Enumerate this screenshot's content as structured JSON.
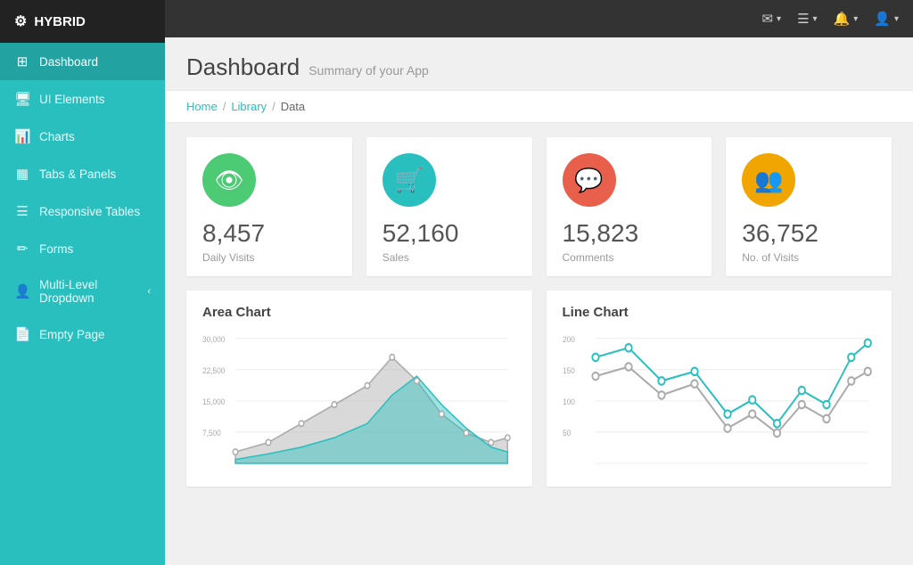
{
  "app": {
    "name": "HYBRID",
    "logo_icon": "⚙"
  },
  "topbar": {
    "items": [
      {
        "id": "mail",
        "icon": "✉",
        "has_dropdown": true
      },
      {
        "id": "menu",
        "icon": "☰",
        "has_dropdown": true
      },
      {
        "id": "bell",
        "icon": "🔔",
        "has_dropdown": true
      },
      {
        "id": "user",
        "icon": "👤",
        "has_dropdown": true
      }
    ]
  },
  "sidebar": {
    "items": [
      {
        "id": "dashboard",
        "label": "Dashboard",
        "icon": "⊞",
        "active": true
      },
      {
        "id": "ui-elements",
        "label": "UI Elements",
        "icon": "🖥",
        "active": false
      },
      {
        "id": "charts",
        "label": "Charts",
        "icon": "📊",
        "active": false
      },
      {
        "id": "tabs-panels",
        "label": "Tabs & Panels",
        "icon": "▦",
        "active": false
      },
      {
        "id": "responsive-tables",
        "label": "Responsive Tables",
        "icon": "☰",
        "active": false
      },
      {
        "id": "forms",
        "label": "Forms",
        "icon": "✏",
        "active": false
      },
      {
        "id": "multi-level",
        "label": "Multi-Level Dropdown",
        "icon": "👤",
        "active": false,
        "has_arrow": true
      },
      {
        "id": "empty-page",
        "label": "Empty Page",
        "icon": "📄",
        "active": false
      }
    ]
  },
  "page": {
    "title": "Dashboard",
    "subtitle": "Summary of your App"
  },
  "breadcrumb": {
    "items": [
      "Home",
      "Library",
      "Data"
    ]
  },
  "stats": [
    {
      "id": "daily-visits",
      "value": "8,457",
      "label": "Daily Visits",
      "icon": "👁",
      "color": "#4cca74"
    },
    {
      "id": "sales",
      "value": "52,160",
      "label": "Sales",
      "icon": "🛒",
      "color": "#2abfbf"
    },
    {
      "id": "comments",
      "value": "15,823",
      "label": "Comments",
      "icon": "💬",
      "color": "#e8604c"
    },
    {
      "id": "no-of-visits",
      "value": "36,752",
      "label": "No. of Visits",
      "icon": "👥",
      "color": "#f0a500"
    }
  ],
  "charts": [
    {
      "id": "area-chart",
      "title": "Area Chart",
      "y_labels": [
        "30,000",
        "22,500",
        "15,000",
        "7,500"
      ],
      "type": "area"
    },
    {
      "id": "line-chart",
      "title": "Line Chart",
      "y_labels": [
        "200",
        "150",
        "100",
        "50"
      ],
      "type": "line"
    }
  ]
}
